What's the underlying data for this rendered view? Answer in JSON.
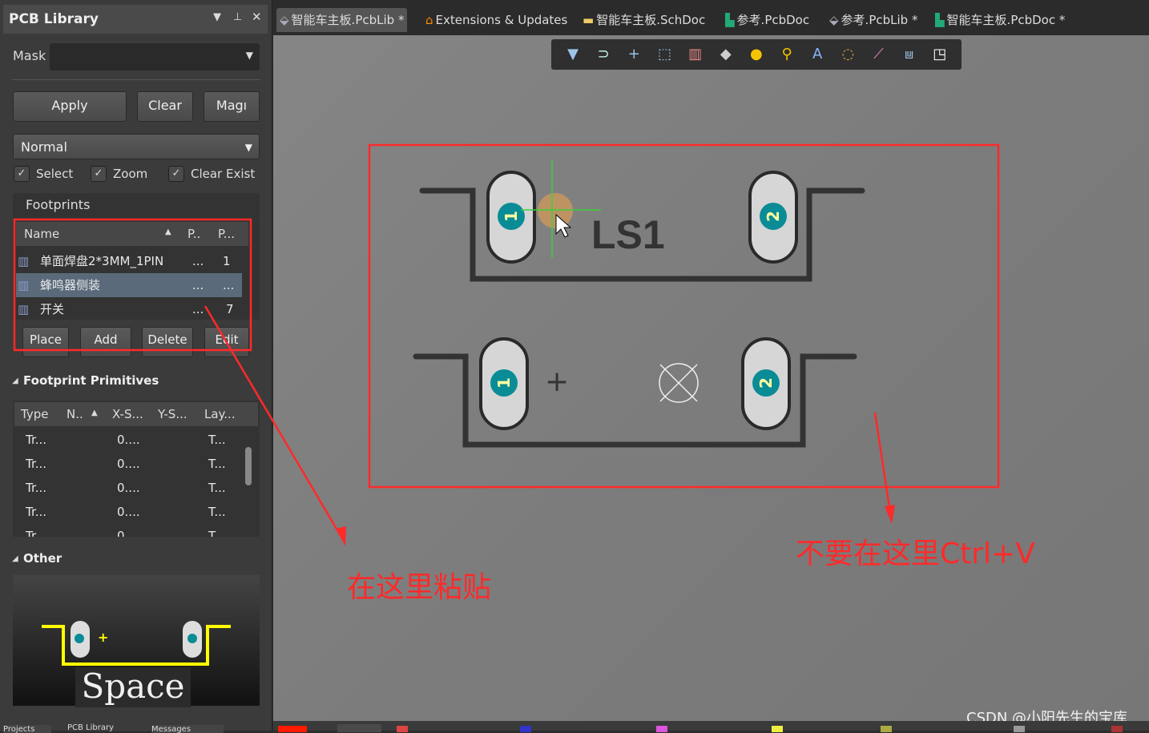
{
  "panel": {
    "title": "PCB Library",
    "mask_label": "Mask",
    "mask_value": "",
    "buttons": {
      "apply": "Apply",
      "clear": "Clear",
      "magnify": "Magı"
    },
    "mode": "Normal",
    "checkboxes": [
      {
        "label": "Select",
        "checked": true
      },
      {
        "label": "Zoom",
        "checked": true
      },
      {
        "label": "Clear Exist",
        "checked": true
      }
    ],
    "footprints_label": "Footprints",
    "footprint_columns": [
      "Name",
      "P..",
      "P..."
    ],
    "footprints": [
      {
        "name": "单面焊盘2*3MM_1PIN",
        "p1": "...",
        "p2": "1",
        "selected": false
      },
      {
        "name": "蜂鸣器侧装",
        "p1": "...",
        "p2": "...",
        "selected": true
      },
      {
        "name": "开关",
        "p1": "...",
        "p2": "7",
        "selected": false
      }
    ],
    "actions": {
      "place": "Place",
      "add": "Add",
      "delete": "Delete",
      "edit": "Edit"
    },
    "primitives_title": "Footprint Primitives",
    "primitive_columns": [
      "Type",
      "N..",
      "X-S...",
      "Y-S...",
      "Lay..."
    ],
    "primitives": [
      {
        "type": "Tr...",
        "x": "0....",
        "layer": "T..."
      },
      {
        "type": "Tr...",
        "x": "0....",
        "layer": "T..."
      },
      {
        "type": "Tr...",
        "x": "0....",
        "layer": "T..."
      },
      {
        "type": "Tr...",
        "x": "0....",
        "layer": "T..."
      },
      {
        "type": "Tr...",
        "x": "0....",
        "layer": "T..."
      }
    ],
    "other_title": "Other",
    "preview_overlay": "Space",
    "bottom_tabs": [
      "Projects",
      "PCB Library",
      "Messages"
    ]
  },
  "tabs": [
    {
      "label": "智能车主板.PcbLib *",
      "icon": "pcblib-icon",
      "active": true
    },
    {
      "label": "Extensions & Updates",
      "icon": "home-icon",
      "active": false
    },
    {
      "label": "智能车主板.SchDoc",
      "icon": "schdoc-icon",
      "active": false
    },
    {
      "label": "参考.PcbDoc",
      "icon": "pcbdoc-icon",
      "active": false
    },
    {
      "label": "参考.PcbLib *",
      "icon": "pcblib-icon",
      "active": false
    },
    {
      "label": "智能车主板.PcbDoc *",
      "icon": "pcbdoc-icon",
      "active": false
    }
  ],
  "toolbar": [
    {
      "icon": "filter-icon",
      "glyph": "▼"
    },
    {
      "icon": "magnet-icon",
      "glyph": "⊃"
    },
    {
      "icon": "cross-icon",
      "glyph": "+"
    },
    {
      "icon": "select-rect-icon",
      "glyph": "⬚"
    },
    {
      "icon": "align-icon",
      "glyph": "▥"
    },
    {
      "icon": "eraser-icon",
      "glyph": "◆"
    },
    {
      "icon": "pad-icon",
      "glyph": "●"
    },
    {
      "icon": "via-icon",
      "glyph": "⚲"
    },
    {
      "icon": "text-icon",
      "glyph": "A"
    },
    {
      "icon": "arc-icon",
      "glyph": "◌"
    },
    {
      "icon": "line-icon",
      "glyph": "⟋"
    },
    {
      "icon": "dimension-icon",
      "glyph": "⩏"
    },
    {
      "icon": "region-icon",
      "glyph": "◳"
    }
  ],
  "canvas": {
    "designator": "LS1",
    "pad_numbers": [
      "1",
      "2"
    ]
  },
  "annotations": {
    "paste_here": "在这里粘贴",
    "not_here": "不要在这里Ctrl+V",
    "color": "#ff2a2a"
  },
  "watermark": "CSDN @小阳先生的宝库",
  "colors": {
    "pad_hole": "#0a8c96",
    "silkscreen": "#333333",
    "preview_outline": "#ffff00"
  }
}
